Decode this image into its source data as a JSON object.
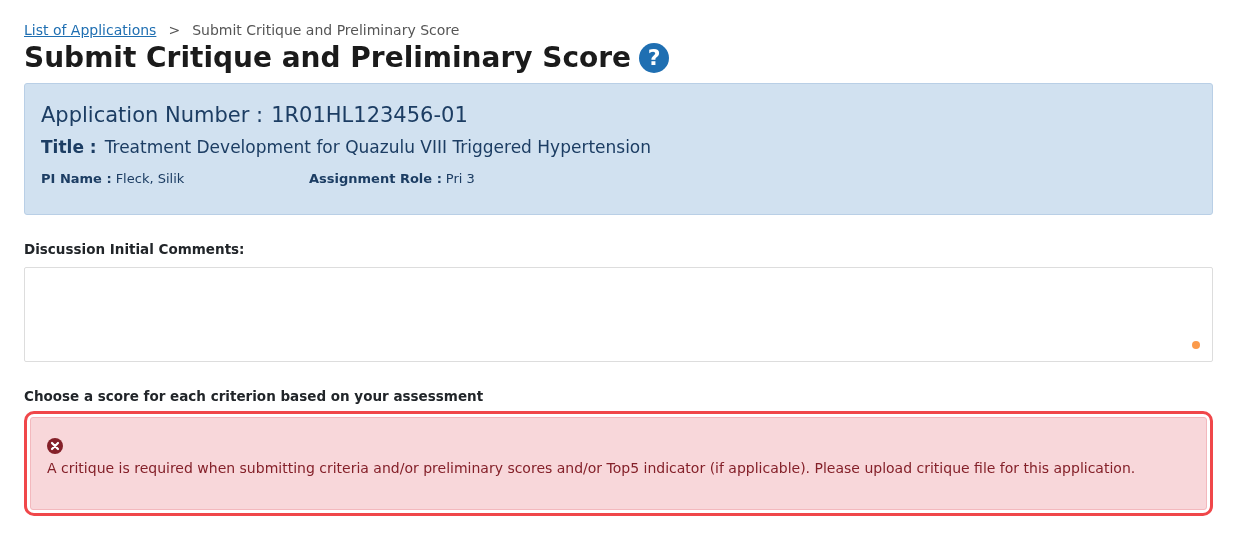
{
  "breadcrumb": [
    {
      "label": "List of Applications",
      "kind": "link"
    },
    {
      "label": ">",
      "kind": "separator"
    },
    {
      "label": "Submit Critique and Preliminary Score",
      "kind": "current"
    }
  ],
  "page_title": "Submit Critique and Preliminary Score",
  "help_icon": "?",
  "application": {
    "number_label": "Application Number :",
    "number": "1R01HL123456-01",
    "title_label": "Title :",
    "title": "Treatment Development for Quazulu VIII Triggered Hypertension",
    "fields": [
      {
        "label": "PI Name :",
        "value": "Fleck, Silik"
      },
      {
        "label": "Assignment Role :",
        "value": "Pri 3"
      }
    ]
  },
  "comments": {
    "label": "Discussion Initial Comments:"
  },
  "scores": {
    "label": "Choose a score for each criterion based on your assessment"
  },
  "alert": {
    "kind": "error",
    "focused": true,
    "message": "A critique is required when submitting criteria and/or preliminary scores and/or Top5 indicator (if applicable). Please upload critique file for this application."
  }
}
